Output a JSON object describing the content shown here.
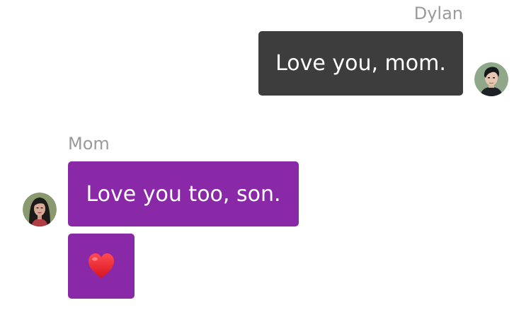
{
  "conversation": {
    "outgoing": {
      "sender": "Dylan",
      "messages": [
        {
          "text": "Love you, mom."
        }
      ],
      "avatar_icon": "dylan-avatar-icon",
      "bubble_color": "#3d3d3d"
    },
    "incoming": {
      "sender": "Mom",
      "messages": [
        {
          "text": "Love you too, son."
        },
        {
          "emoji": "heart-emoji-icon"
        }
      ],
      "avatar_icon": "mom-avatar-icon",
      "bubble_color": "#8a29a8"
    }
  },
  "colors": {
    "sender_label": "#9a9a9a",
    "message_text": "#ffffff",
    "heart": "#e0222a"
  }
}
